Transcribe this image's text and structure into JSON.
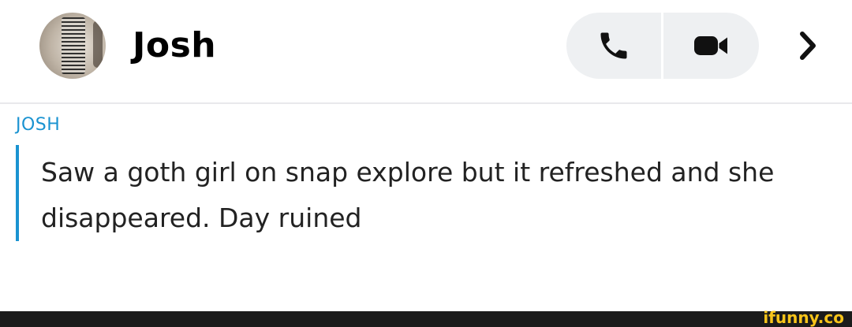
{
  "header": {
    "contact_name": "Josh",
    "avatar_icon": "contact-avatar",
    "call_icon": "phone-icon",
    "video_icon": "video-camera-icon",
    "chevron_icon": "chevron-right-icon"
  },
  "chat": {
    "sender": "JOSH",
    "message": "Saw a goth girl on snap explore but it refreshed and she disappeared. Day ruined",
    "accent_color": "#1a93d1"
  },
  "footer": {
    "watermark": "ifunny.co",
    "watermark_color": "#f7c41a"
  }
}
